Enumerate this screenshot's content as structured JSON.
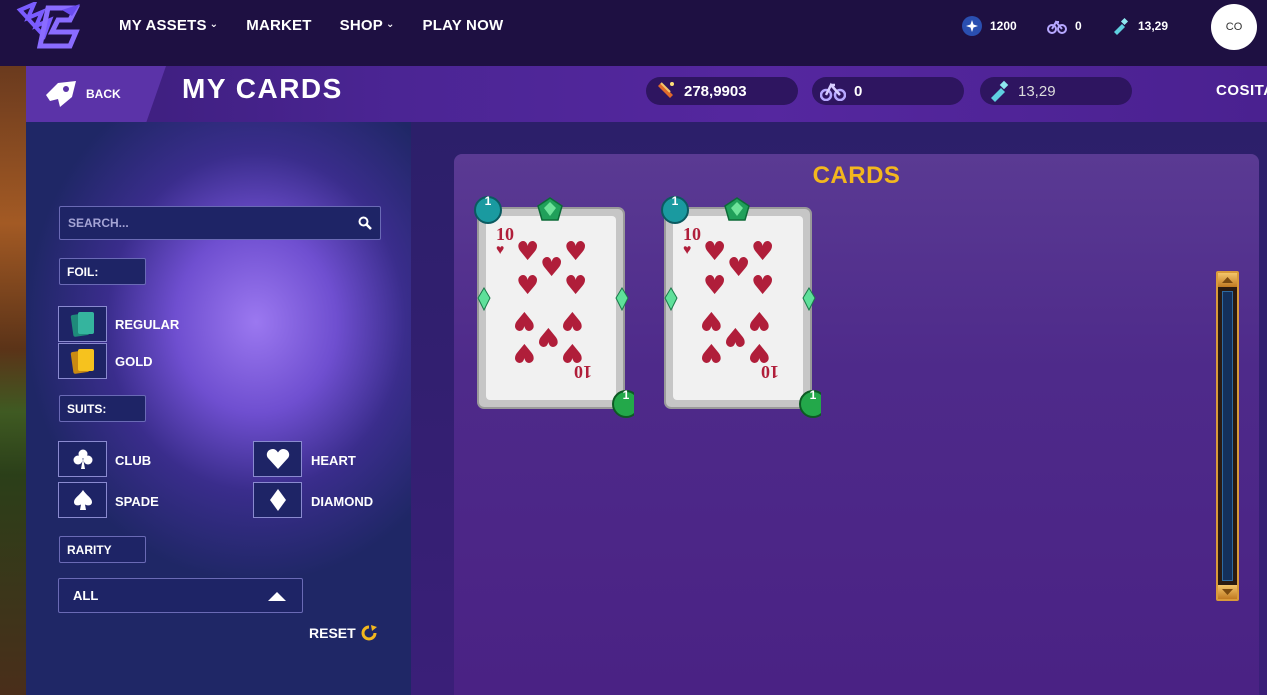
{
  "nav": {
    "links": [
      {
        "label": "MY ASSETS",
        "has_chevron": true
      },
      {
        "label": "MARKET",
        "has_chevron": false
      },
      {
        "label": "SHOP",
        "has_chevron": true
      },
      {
        "label": "PLAY NOW",
        "has_chevron": false
      }
    ],
    "stats": [
      {
        "icon": "star-badge-icon",
        "value": "1200"
      },
      {
        "icon": "bike-icon",
        "value": "0"
      },
      {
        "icon": "bottle-icon",
        "value": "13,29"
      }
    ],
    "avatar_initials": "CO"
  },
  "header": {
    "back_label": "BACK",
    "title": "MY CARDS",
    "balances": [
      {
        "icon": "firework-icon",
        "value": "278,9903"
      },
      {
        "icon": "bike-icon",
        "value": "0"
      },
      {
        "icon": "bottle-icon",
        "value": "13,29"
      }
    ],
    "username": "COSITA"
  },
  "sidebar": {
    "search_placeholder": "SEARCH...",
    "foil_label": "FOIL:",
    "foil_options": [
      "REGULAR",
      "GOLD"
    ],
    "suits_label": "SUITS:",
    "suit_options": [
      "CLUB",
      "HEART",
      "SPADE",
      "DIAMOND"
    ],
    "rarity_label": "RARITY",
    "rarity_selected": "ALL",
    "reset_label": "RESET"
  },
  "main": {
    "title": "CARDS",
    "cards": [
      {
        "rank": "10",
        "suit": "heart",
        "level_top": "1",
        "level_bottom": "1"
      },
      {
        "rank": "10",
        "suit": "heart",
        "level_top": "1",
        "level_bottom": "1"
      }
    ]
  },
  "colors": {
    "accent_gold": "#f3b71e",
    "nav_bg": "#1e1042",
    "card_red": "#b01e3a"
  }
}
